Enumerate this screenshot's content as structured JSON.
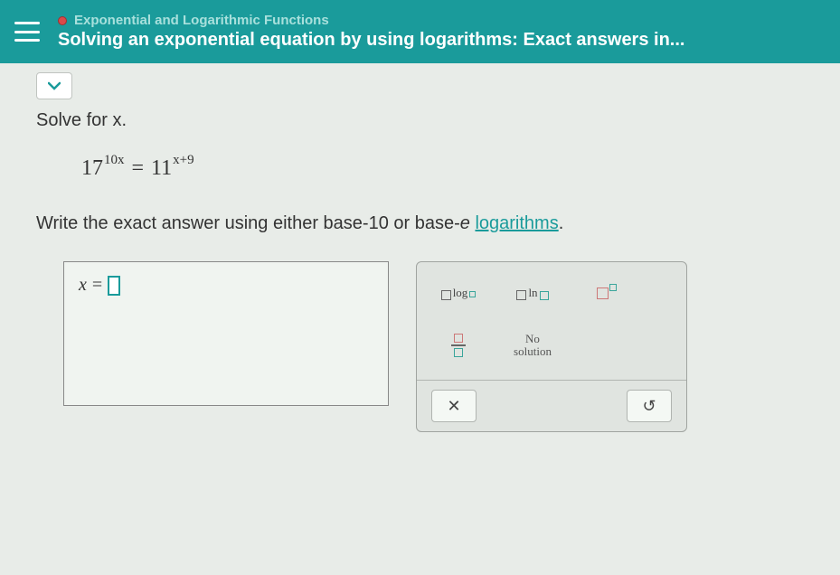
{
  "header": {
    "category": "Exponential and Logarithmic Functions",
    "title": "Solving an exponential equation by using logarithms: Exact answers in..."
  },
  "problem": {
    "prompt1": "Solve for x.",
    "equation": {
      "left_base": "17",
      "left_exp": "10x",
      "equals": "=",
      "right_base": "11",
      "right_exp": "x+9"
    },
    "prompt2_pre": "Write the exact answer using either base-10 or base-",
    "prompt2_ital": "e",
    "prompt2_mid": " ",
    "prompt2_link": "logarithms",
    "prompt2_post": "."
  },
  "answer": {
    "var": "x",
    "eq": "="
  },
  "keypad": {
    "log_label": "log",
    "ln_label": "ln",
    "no_solution": "No\nsolution",
    "clear": "✕",
    "undo": "↺"
  }
}
